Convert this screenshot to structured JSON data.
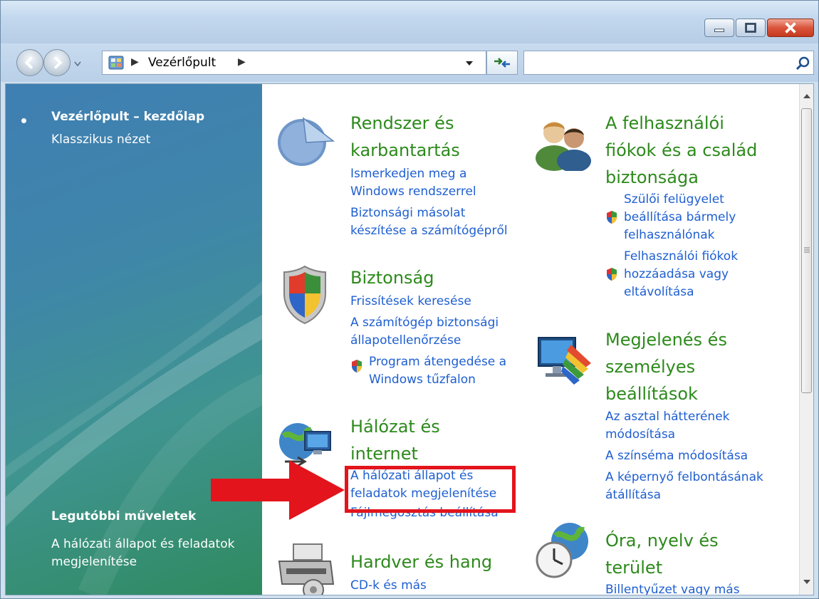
{
  "address": {
    "root_icon": "control-panel-icon",
    "crumb": "Vezérlőpult"
  },
  "search": {
    "placeholder": "",
    "value": ""
  },
  "left_pane": {
    "home": "Vezérlőpult – kezdőlap",
    "classic": "Klasszikus nézet",
    "recent_heading": "Legutóbbi műveletek",
    "recent_link": "A hálózati állapot és feladatok megjelenítése"
  },
  "categories": {
    "system": {
      "title_1": "Rendszer és",
      "title_2": "karbantartás",
      "links": [
        "Ismerkedjen meg a",
        "Windows rendszerrel",
        "Biztonsági másolat",
        "készítése a számítógépről"
      ]
    },
    "security": {
      "title": "Biztonság",
      "links": [
        "Frissítések keresése",
        "A számítógép biztonsági",
        "állapotellenőrzése",
        "Program átengedése a",
        "Windows tűzfalon"
      ]
    },
    "network": {
      "title_1": "Hálózat és",
      "title_2": "internet",
      "links": [
        "A hálózati állapot és",
        "feladatok megjelenítése",
        "Fájlmegosztás beállítása"
      ]
    },
    "hardware": {
      "title": "Hardver és hang",
      "links": [
        "CD-k és más"
      ]
    },
    "users": {
      "title_1": "A felhasználói",
      "title_2": "fiókok és a család",
      "title_3": "biztonsága",
      "links": [
        "Szülői felügyelet",
        "beállítása bármely",
        "felhasználónak",
        "Felhasználói fiókok",
        "hozzáadása vagy",
        "eltávolítása"
      ]
    },
    "appearance": {
      "title_1": "Megjelenés és",
      "title_2": "személyes",
      "title_3": "beállítások",
      "links": [
        "Az asztal hátterének",
        "módosítása",
        "A színséma módosítása",
        "A képernyő felbontásának",
        "átállítása"
      ]
    },
    "clock": {
      "title_1": "Óra, nyelv és",
      "title_2": "terület",
      "links": [
        "Billentyűzet vagy más"
      ]
    }
  },
  "annotation": {
    "color": "#e3141c"
  },
  "colors": {
    "category_title": "#2d8a1c",
    "link": "#1e5fd0"
  }
}
